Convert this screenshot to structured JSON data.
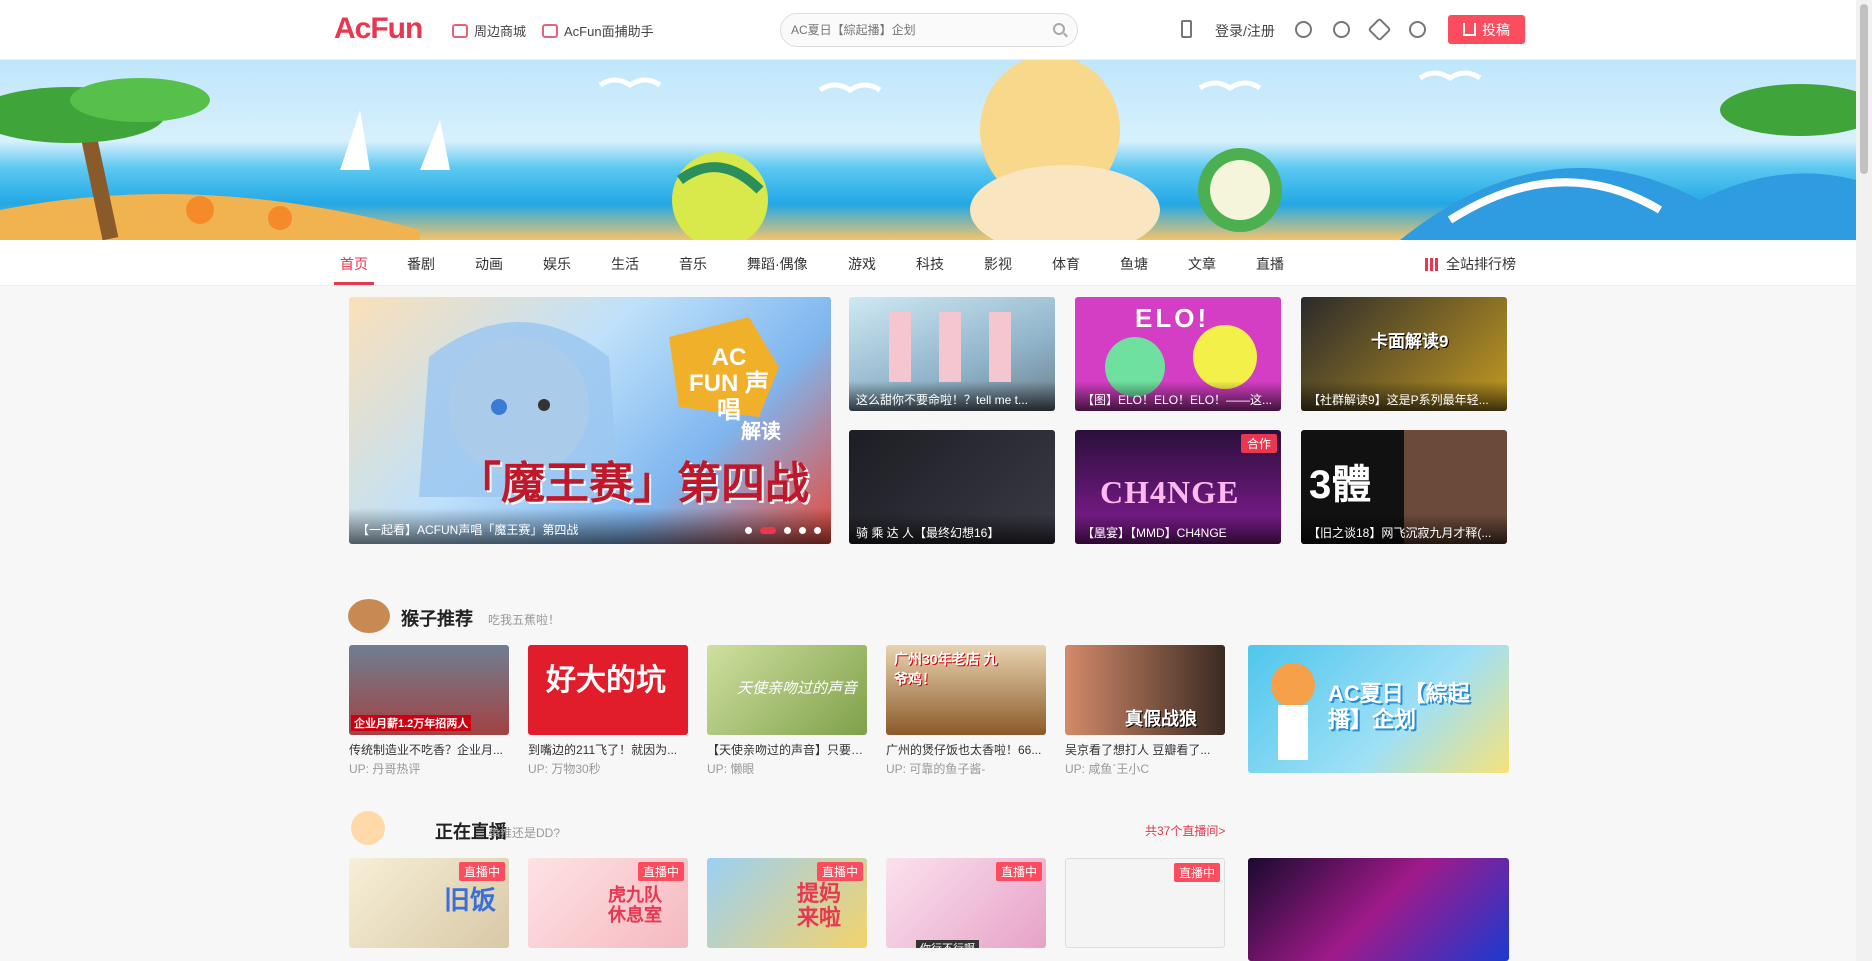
{
  "header": {
    "logo": "AcFun",
    "links": [
      "周边商城",
      "AcFun面捕助手"
    ],
    "search_placeholder": "AC夏日【綜起播】企划",
    "login": "登录/注册",
    "upload": "投稿"
  },
  "nav": {
    "items": [
      "首页",
      "番剧",
      "动画",
      "娱乐",
      "生活",
      "音乐",
      "舞蹈·偶像",
      "游戏",
      "科技",
      "影视",
      "体育",
      "鱼塘",
      "文章",
      "直播"
    ],
    "active": "首页",
    "rank": "全站排行榜"
  },
  "hero": {
    "caption": "【一起看】ACFUN声唱「魔王赛」第四战",
    "headline": "「魔王赛」第四战",
    "badge": "AC FUN 声唱",
    "badge_sub": "解读"
  },
  "thumbs": [
    {
      "caption": "这么甜你不要命啦！？tell me t..."
    },
    {
      "caption": "【图】ELO！ELO！ELO！——这...",
      "art": "ELO!"
    },
    {
      "caption": "【社群解读9】这是P系列最年轻...",
      "art": "卡面解读9"
    },
    {
      "caption": "骑 乘 达 人【最终幻想16】"
    },
    {
      "caption": "【凰宴】【MMD】CH4NGE",
      "tag": "合作",
      "art": "CH4NGE"
    },
    {
      "caption": "【旧之谈18】网飞沉寂九月才释(...",
      "art": "3體"
    }
  ],
  "sections": [
    {
      "title": "猴子推荐",
      "subtitle": "吃我五蕉啦！",
      "more": ""
    },
    {
      "title": "正在直播",
      "subtitle": "单推还是DD?",
      "more": "共37个直播间>"
    }
  ],
  "recommend": [
    {
      "title": "传统制造业不吃香？企业月...",
      "up": "UP:  丹哥热评",
      "art": "企业月薪1.2万年招两人"
    },
    {
      "title": "到嘴边的211飞了！就因为...",
      "up": "UP:  万物30秒",
      "art": "好大的坑"
    },
    {
      "title": "【天使亲吻过的声音】只要你...",
      "up": "UP:  懒眼",
      "art": "天使亲吻过的声音"
    },
    {
      "title": "广州的煲仔饭也太香啦！66...",
      "up": "UP:  可靠的鱼子酱-",
      "art": "广州30年老店 九爷鸡！"
    },
    {
      "title": "吴京看了想打人 豆瓣看了...",
      "up": "UP:  咸鱼`王小C",
      "art": "真假战狼"
    }
  ],
  "ad": {
    "text": "AC夏日【綜起播】企划"
  },
  "live_tag": "直播中",
  "live_cards": [
    {
      "art": "旧饭"
    },
    {
      "art": "虎九队 休息室"
    },
    {
      "art": "提妈 来啦"
    },
    {
      "art": "你行不行啊"
    },
    {
      "art": ""
    }
  ],
  "colors": {
    "brand": "#e8374f",
    "upload": "#fd4c5d"
  }
}
